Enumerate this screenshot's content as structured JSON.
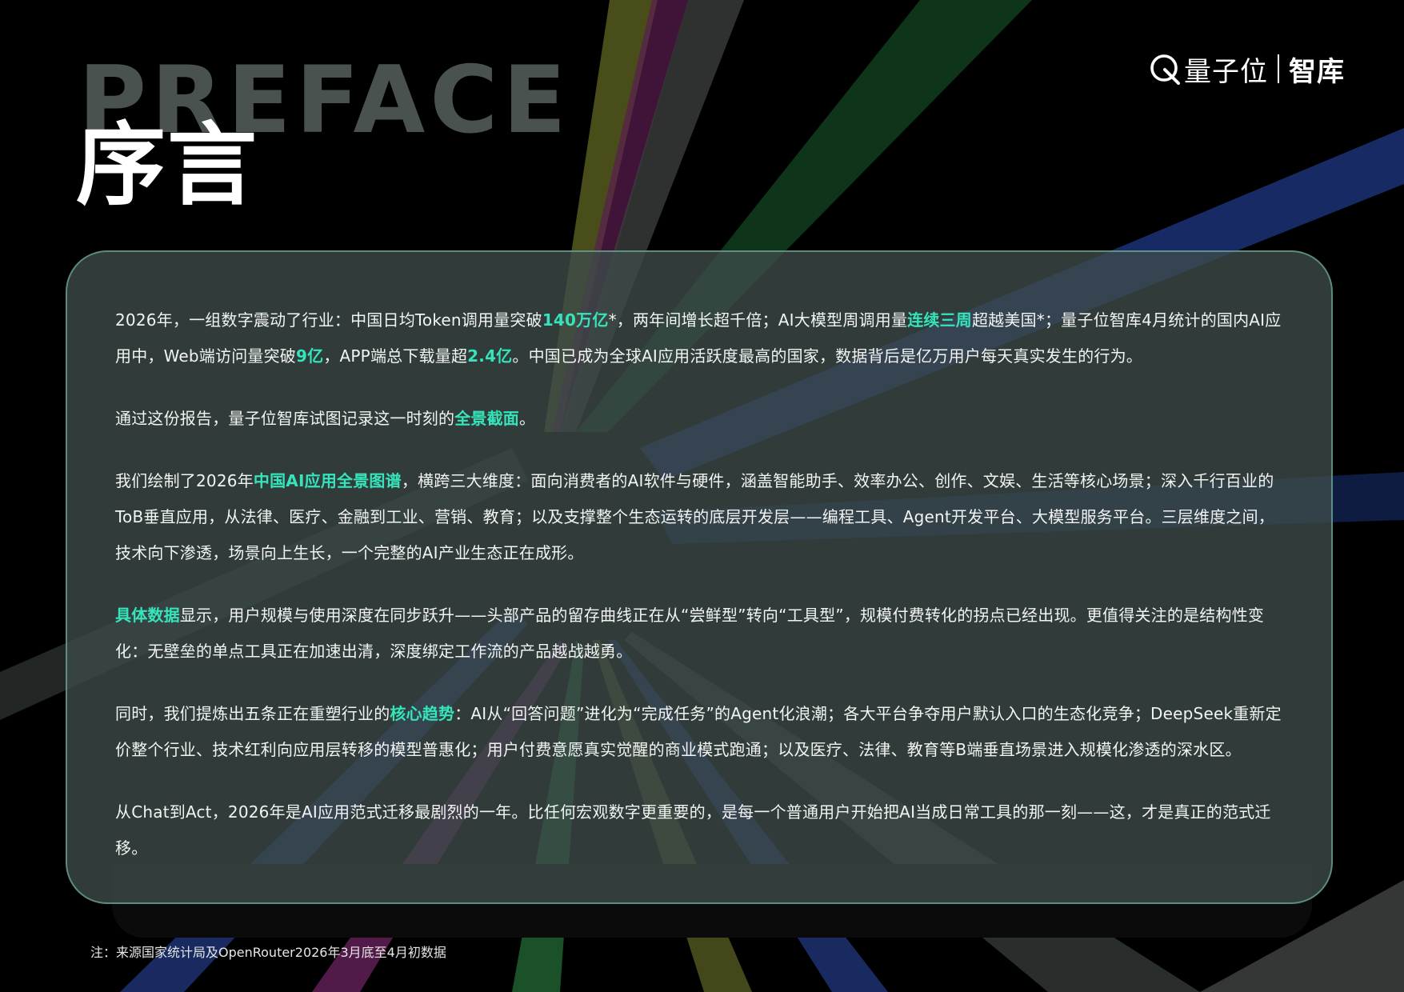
{
  "header": {
    "background_word": "PREFACE",
    "title": "序言"
  },
  "logo": {
    "icon": "qbit-q-icon",
    "name": "量子位",
    "sub": "智库"
  },
  "colors": {
    "background": "#000000",
    "highlight": "#35e4bb",
    "card": "#3e4c4a",
    "text": "#f2f4f3"
  },
  "content": {
    "paragraphs": [
      [
        {
          "t": "2026年，一组数字震动了行业：中国日均Token调用量突破"
        },
        {
          "t": "140万亿",
          "hl": true
        },
        {
          "t": "*，两年间增长超千倍；AI大模型周调用量"
        },
        {
          "t": "连续三周",
          "hl": true
        },
        {
          "t": "超越美国*；量子位智库4月统计的国内AI应用中，Web端访问量突破"
        },
        {
          "t": "9亿",
          "hl": true
        },
        {
          "t": "，APP端总下载量超"
        },
        {
          "t": "2.4亿",
          "hl": true
        },
        {
          "t": "。中国已成为全球AI应用活跃度最高的国家，数据背后是亿万用户每天真实发生的行为。"
        }
      ],
      [
        {
          "t": "通过这份报告，量子位智库试图记录这一时刻的"
        },
        {
          "t": "全景截面",
          "hl": true
        },
        {
          "t": "。"
        }
      ],
      [
        {
          "t": "我们绘制了2026年"
        },
        {
          "t": "中国AI应用全景图谱",
          "hl": true
        },
        {
          "t": "，横跨三大维度：面向消费者的AI软件与硬件，涵盖智能助手、效率办公、创作、文娱、生活等核心场景；深入千行百业的ToB垂直应用，从法律、医疗、金融到工业、营销、教育；以及支撑整个生态运转的底层开发层——编程工具、Agent开发平台、大模型服务平台。三层维度之间，技术向下渗透，场景向上生长，一个完整的AI产业生态正在成形。"
        }
      ],
      [
        {
          "t": "具体数据",
          "hl": true
        },
        {
          "t": "显示，用户规模与使用深度在同步跃升——头部产品的留存曲线正在从“尝鲜型”转向“工具型”，规模付费转化的拐点已经出现。更值得关注的是结构性变化：无壁垒的单点工具正在加速出清，深度绑定工作流的产品越战越勇。"
        }
      ],
      [
        {
          "t": "同时，我们提炼出五条正在重塑行业的"
        },
        {
          "t": "核心趋势",
          "hl": true
        },
        {
          "t": "：AI从“回答问题”进化为“完成任务”的Agent化浪潮；各大平台争夺用户默认入口的生态化竞争；DeepSeek重新定价整个行业、技术红利向应用层转移的模型普惠化；用户付费意愿真实觉醒的商业模式跑通；以及医疗、法律、教育等B端垂直场景进入规模化渗透的深水区。"
        }
      ],
      [
        {
          "t": "从Chat到Act，2026年是AI应用范式迁移最剧烈的一年。比任何宏观数字更重要的，是每一个普通用户开始把AI当成日常工具的那一刻——这，才是真正的范式迁移。"
        }
      ]
    ]
  },
  "footnote": "注：来源国家统计局及OpenRouter2026年3月底至4月初数据"
}
